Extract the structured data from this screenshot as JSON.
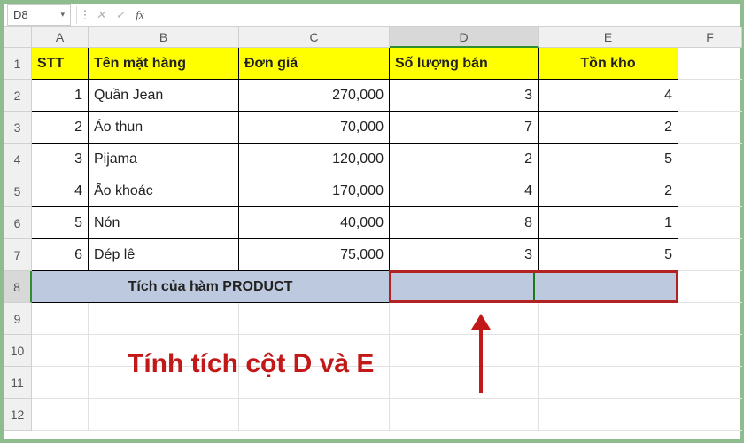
{
  "namebox": "D8",
  "formula": "",
  "columns": [
    "A",
    "B",
    "C",
    "D",
    "E",
    "F"
  ],
  "headers": {
    "a": "STT",
    "b": "Tên mặt hàng",
    "c": "Đơn giá",
    "d": "Số lượng bán",
    "e": "Tồn kho"
  },
  "rows": [
    {
      "stt": "1",
      "name": "Quần Jean",
      "price": "270,000",
      "qty": "3",
      "stock": "4"
    },
    {
      "stt": "2",
      "name": "Áo thun",
      "price": "70,000",
      "qty": "7",
      "stock": "2"
    },
    {
      "stt": "3",
      "name": "Pijama",
      "price": "120,000",
      "qty": "2",
      "stock": "5"
    },
    {
      "stt": "4",
      "name": "Ấo khoác",
      "price": "170,000",
      "qty": "4",
      "stock": "2"
    },
    {
      "stt": "5",
      "name": "Nón",
      "price": "40,000",
      "qty": "8",
      "stock": "1"
    },
    {
      "stt": "6",
      "name": "Dép lê",
      "price": "75,000",
      "qty": "3",
      "stock": "5"
    }
  ],
  "merge_label": "Tích của hàm PRODUCT",
  "callout": "Tính tích cột D và E",
  "row_numbers": [
    "1",
    "2",
    "3",
    "4",
    "5",
    "6",
    "7",
    "8",
    "9",
    "10",
    "11",
    "12"
  ],
  "chart_data": {
    "type": "table",
    "columns": [
      "STT",
      "Tên mặt hàng",
      "Đơn giá",
      "Số lượng bán",
      "Tồn kho"
    ],
    "data": [
      [
        1,
        "Quần Jean",
        270000,
        3,
        4
      ],
      [
        2,
        "Áo thun",
        70000,
        7,
        2
      ],
      [
        3,
        "Pijama",
        120000,
        2,
        5
      ],
      [
        4,
        "Ấo khoác",
        170000,
        4,
        2
      ],
      [
        5,
        "Nón",
        40000,
        8,
        1
      ],
      [
        6,
        "Dép lê",
        75000,
        3,
        5
      ]
    ]
  }
}
